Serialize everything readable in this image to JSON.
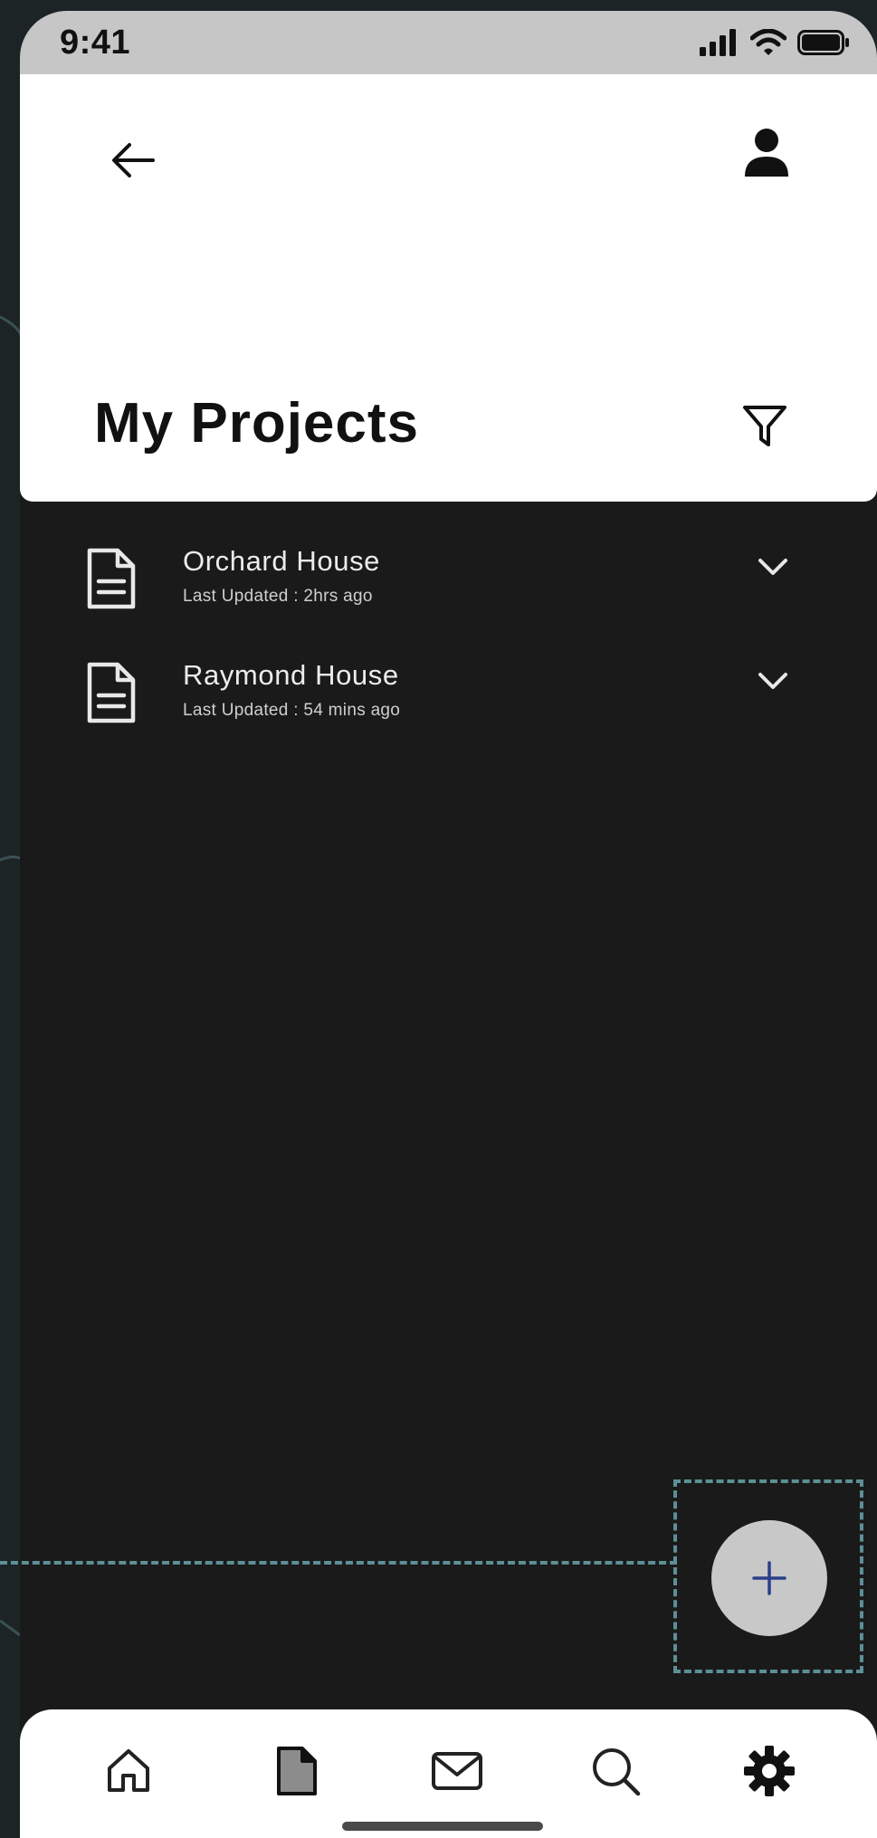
{
  "status_bar": {
    "time": "9:41"
  },
  "header": {
    "title": "My Projects"
  },
  "projects": [
    {
      "name": "Orchard House",
      "updated": "Last Updated : 2hrs ago"
    },
    {
      "name": "Raymond House",
      "updated": "Last Updated : 54 mins ago"
    }
  ],
  "bottom_nav": {
    "items": [
      {
        "icon": "home-icon"
      },
      {
        "icon": "document-icon",
        "active": true
      },
      {
        "icon": "mail-icon"
      },
      {
        "icon": "search-icon"
      },
      {
        "icon": "gear-icon"
      }
    ]
  },
  "colors": {
    "header_bg": "#ffffff",
    "content_bg": "#1a1a1a",
    "status_bar_bg": "#c6c6c6",
    "fab_bg": "#c8c8c8",
    "fab_plus": "#2a3f8a",
    "annotation_dash": "#5c8f96"
  }
}
